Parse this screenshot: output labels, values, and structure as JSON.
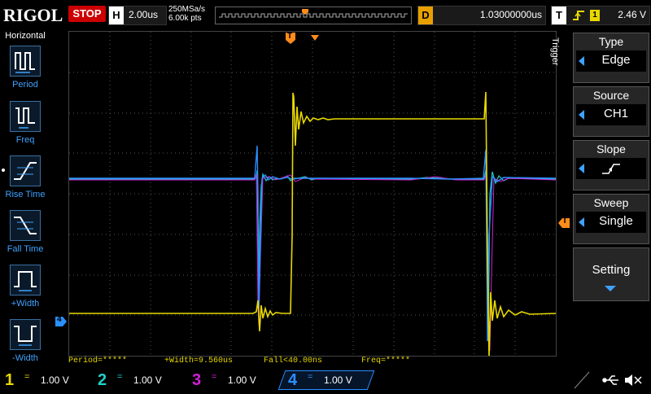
{
  "header": {
    "logo": "RIGOL",
    "run_state": "STOP",
    "horizontal_key": "H",
    "timebase": "2.00us",
    "sample_rate": "250MSa/s",
    "points": "6.00k pts",
    "delay_key": "D",
    "delay": "1.03000000us",
    "trigger_key": "T",
    "trigger_source_num": "1",
    "trigger_level": "2.46 V"
  },
  "left_panel": {
    "title": "Horizontal",
    "items": [
      {
        "label": "Period",
        "icon": "period-icon"
      },
      {
        "label": "Freq",
        "icon": "freq-icon"
      },
      {
        "label": "Rise Time",
        "icon": "rise-time-icon"
      },
      {
        "label": "Fall Time",
        "icon": "fall-time-icon"
      },
      {
        "label": "+Width",
        "icon": "pos-width-icon"
      },
      {
        "label": "-Width",
        "icon": "neg-width-icon"
      }
    ]
  },
  "right_panel": {
    "side_label": "Trigger",
    "groups": [
      {
        "title": "Type",
        "value": "Edge"
      },
      {
        "title": "Source",
        "value": "CH1"
      },
      {
        "title": "Slope",
        "value": ""
      },
      {
        "title": "Sweep",
        "value": "Single"
      },
      {
        "title": "Setting",
        "value": ""
      }
    ]
  },
  "measurements": {
    "period": "Period=*****",
    "pos_width": "+Width=9.560us",
    "fall": "Fall<40.00ns",
    "freq": "Freq=*****"
  },
  "channels": [
    {
      "num": "1",
      "coupling": "=",
      "scale": "1.00 V",
      "color": "#e8d800"
    },
    {
      "num": "2",
      "coupling": "=",
      "scale": "1.00 V",
      "color": "#1fd1c6"
    },
    {
      "num": "3",
      "coupling": "=",
      "scale": "1.00 V",
      "color": "#d21fd8"
    },
    {
      "num": "4",
      "coupling": "=",
      "scale": "1.00 V",
      "color": "#2a8fff"
    }
  ],
  "markers": {
    "trigger_pos": "T",
    "trigger_level": "T",
    "ch4_ground": "4"
  },
  "colors": {
    "ch1": "#e8d800",
    "ch2": "#1fd1c6",
    "ch3": "#d21fd8",
    "ch4": "#2a8fff",
    "trigger": "#ff8c1a",
    "grid": "#555555"
  }
}
